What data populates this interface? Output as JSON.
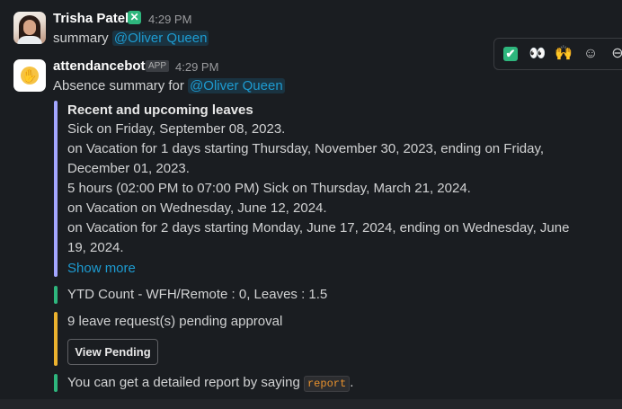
{
  "message1": {
    "author": "Trisha Patel",
    "time": "4:29 PM",
    "text_prefix": "summary",
    "mention": "@Oliver Queen"
  },
  "message2": {
    "author": "attendancebot",
    "badge": "APP",
    "time": "4:29 PM",
    "text_prefix": "Absence summary for",
    "mention": "@Oliver Queen"
  },
  "attachment": {
    "title": "Recent and upcoming leaves",
    "lines": [
      "Sick on Friday, September 08, 2023.",
      "on Vacation for 1 days starting Thursday, November 30, 2023, ending on Friday,",
      "December 01, 2023.",
      "5 hours (02:00 PM to 07:00 PM) Sick on Thursday, March 21, 2024.",
      "on Vacation on Wednesday, June 12, 2024.",
      "on Vacation for 2 days starting Monday, June 17, 2024, ending on Wednesday, June",
      "19, 2024."
    ],
    "show_more": "Show more",
    "ytd": "YTD Count - WFH/Remote : 0, Leaves : 1.5",
    "pending_text": "9 leave request(s) pending approval",
    "pending_button": "View Pending",
    "report_prefix": "You can get a detailed report by saying",
    "report_code": "report",
    "report_suffix": "."
  },
  "reactions": {
    "check": "✔",
    "eyes": "👀",
    "hands": "🙌",
    "add_emoji": "☺",
    "more": "⊖"
  },
  "colors": {
    "bg": "#1a1d21",
    "link": "#1d9bd1",
    "purple_bar": "#a3a6ff",
    "green_bar": "#2eb67d",
    "orange_bar": "#ecb22e"
  }
}
